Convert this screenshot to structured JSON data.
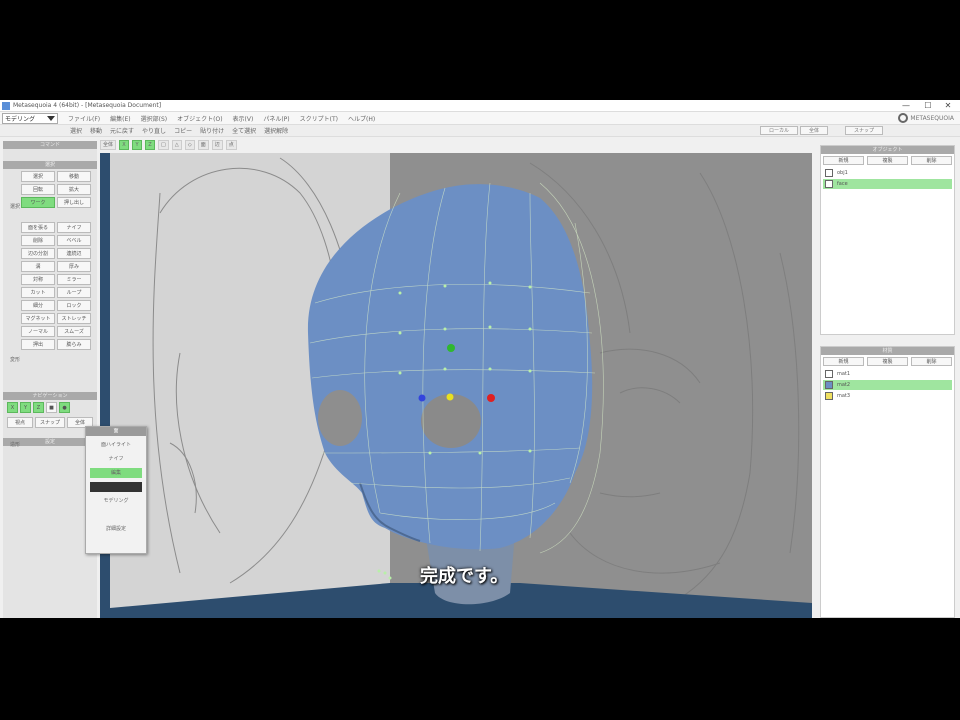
{
  "window": {
    "title": "Metasequoia 4 (64bit) - [Metasequoia Document]",
    "minimize": "—",
    "maximize": "☐",
    "close": "✕"
  },
  "menubar": {
    "mode": "モデリング",
    "items": [
      "ファイル(F)",
      "編集(E)",
      "選択部(S)",
      "オブジェクト(O)",
      "表示(V)",
      "パネル(P)",
      "スクリプト(T)",
      "ヘルプ(H)"
    ],
    "logo": "METASEQUOIA"
  },
  "toolbar1": {
    "items": [
      "選択",
      "移動",
      "元に戻す",
      "やり直し",
      "コピー",
      "貼り付け",
      "全て選択",
      "選択解除"
    ],
    "right": [
      "ローカル",
      "全体",
      "スナップ"
    ]
  },
  "toolbar2": {
    "buttons": [
      "全体",
      "X",
      "Y",
      "Z",
      "□",
      "△",
      "◇",
      "面",
      "辺",
      "点"
    ]
  },
  "left_panel": {
    "header1": "コマンド",
    "header2": "選択",
    "buttons_a": [
      "選択",
      "移動",
      "回転",
      "拡大",
      "ワーク",
      "押し出し"
    ],
    "buttons_b": [
      "面を張る",
      "ナイフ",
      "削除",
      "ベベル",
      "辺の分割",
      "連続辺",
      "溝",
      "厚み",
      "対称",
      "ミラー",
      "カット",
      "ループ",
      "細分",
      "ロック",
      "マグネット",
      "ストレッチ",
      "ノーマル",
      "スムーズ",
      "押出",
      "膨らみ"
    ],
    "side_labels": [
      "選択",
      "変形",
      "造形"
    ],
    "snap_header": "ナビゲーション",
    "snap_row": [
      "X",
      "Y",
      "Z",
      "■",
      "●"
    ],
    "bottom": [
      "視点",
      "スナップ",
      "全体"
    ],
    "footer": "設定"
  },
  "popup": {
    "title": "面",
    "items": [
      "面ハイライト",
      "ナイフ",
      "編集",
      "",
      "モデリング",
      "",
      "詳細設定"
    ]
  },
  "viewport": {
    "subtitle": "完成です。"
  },
  "right_panel": {
    "objects_header": "オブジェクト",
    "objects_buttons": [
      "新規",
      "複製",
      "削除"
    ],
    "objects": [
      "obj1",
      "face"
    ],
    "materials_header": "材質",
    "materials_buttons": [
      "新規",
      "複製",
      "削除"
    ],
    "materials": [
      "mat1",
      "mat2",
      "mat3"
    ]
  },
  "colors": {
    "accent": "#7fdc7f",
    "model": "#6c8fc4",
    "viewport_bg": "#9a9a9a",
    "floor": "#2d4d6e"
  }
}
